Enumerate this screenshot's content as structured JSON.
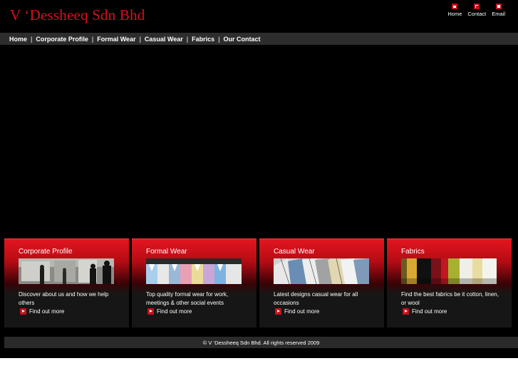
{
  "header": {
    "logo": "V ‘Dessheeq Sdn Bhd",
    "top_links": [
      {
        "label": "Home",
        "icon": "home-icon"
      },
      {
        "label": "Contact",
        "icon": "contact-icon"
      },
      {
        "label": "Email",
        "icon": "email-icon"
      }
    ]
  },
  "nav": {
    "items": [
      "Home",
      "Corporate Profile",
      "Formal Wear",
      "Casual Wear",
      "Fabrics",
      "Our Contact"
    ],
    "separator": "|"
  },
  "cards": [
    {
      "title": "Corporate Profile",
      "desc": "Discover about us and how we help others",
      "link": "Find out more",
      "image": "office-people-photo"
    },
    {
      "title": "Formal Wear",
      "desc": "Top quality formal wear for work, meetings & other social events",
      "link": "Find out more",
      "image": "formal-shirts-photo"
    },
    {
      "title": "Casual Wear",
      "desc": "Latest designs casual wear for all occasions",
      "link": "Find out more",
      "image": "casual-shirts-photo"
    },
    {
      "title": "Fabrics",
      "desc": "Find the best fabrics be it cotton, linen, or wool",
      "link": "Find out more",
      "image": "fabric-swatches-photo"
    }
  ],
  "footer": {
    "copyright": "© V ‘Dessheeq Sdn Bhd. All rights reserved 2009"
  },
  "colors": {
    "accent": "#d8101c",
    "background": "#000000",
    "nav_bg": "#2d2d2d"
  }
}
